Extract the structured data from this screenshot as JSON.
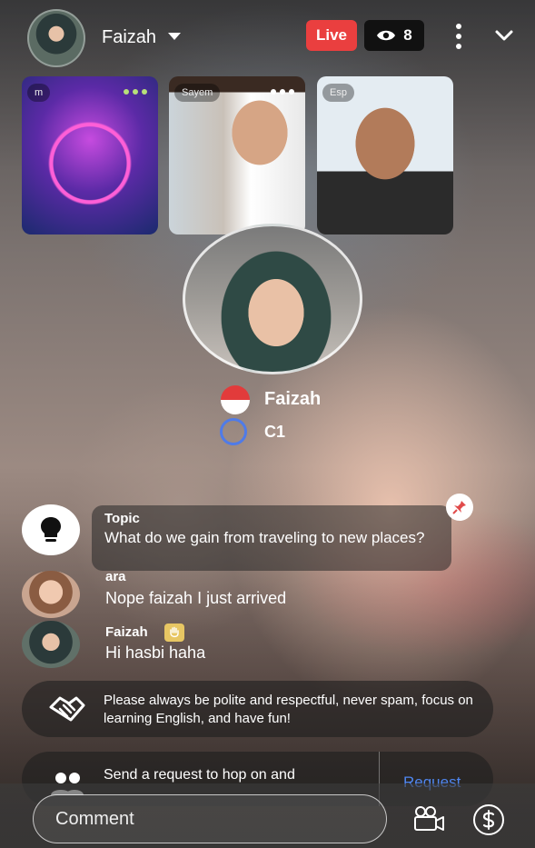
{
  "host": {
    "name": "Faizah"
  },
  "live_label": "Live",
  "viewers": "8",
  "tiles": [
    {
      "label": "m"
    },
    {
      "label": "Sayem"
    },
    {
      "label": "Esp"
    }
  ],
  "speaker": {
    "name": "Faizah",
    "level": "C1"
  },
  "topic": {
    "label": "Topic",
    "text": "What do we gain from traveling to new places?"
  },
  "messages": [
    {
      "name": "ara",
      "text": "Nope faizah I just arrived"
    },
    {
      "name": "Faizah",
      "text": "Hi hasbi haha"
    }
  ],
  "rules": "Please always be polite and respectful, never spam, focus on learning English, and have fun!",
  "request": {
    "text": "Send a request to hop on and",
    "button": "Request"
  },
  "comment": {
    "placeholder": "Comment"
  },
  "colors": {
    "live": "#ea3f3f",
    "accent": "#4f86f0",
    "level_ring": "#4f7be8"
  }
}
